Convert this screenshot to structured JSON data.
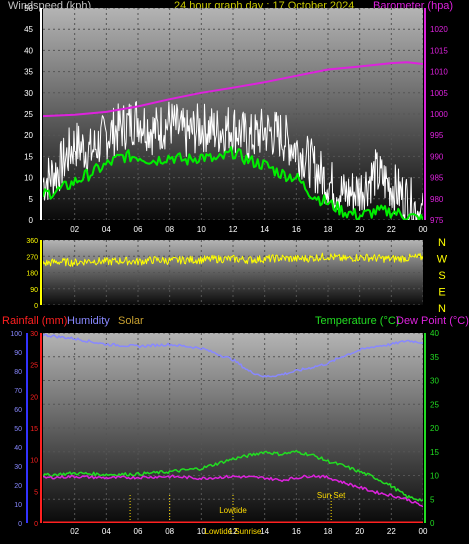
{
  "header": {
    "wind_label": "Windspeed (kph)",
    "title": "24 hour graph day : 17 October 2024",
    "baro_label": "Barometer (hpa)"
  },
  "colors": {
    "wind_gust": "#ffffff",
    "wind_avg": "#00ee00",
    "barometer": "#dd22dd",
    "wind_dir": "#ffff00",
    "humidity": "#8888ff",
    "temperature": "#22dd22",
    "dew_point": "#dd22dd",
    "rainfall": "#ff2020",
    "solar": "#c8a030",
    "axis_left_bottom": "#3333ff",
    "tide": "#ffdd00"
  },
  "bottom_labels": {
    "rain": "Rainfall (mm)",
    "humidity": "Humidity",
    "solar": "Solar",
    "temperature": "Temperature (°C)",
    "dewpoint": "Dew Point (°C)"
  },
  "annotations": {
    "lowtide_1": "Lowtide",
    "lowtide_2": "Lowtide",
    "sunrise": "Sunrise",
    "sunset": "Sun Set"
  },
  "compass": [
    "N",
    "W",
    "S",
    "E",
    "N"
  ],
  "chart_data": [
    {
      "type": "line",
      "x_tick_labels": [
        "02",
        "04",
        "06",
        "08",
        "10",
        "12",
        "14",
        "16",
        "18",
        "20",
        "22",
        "00"
      ],
      "xlim_hours": [
        0,
        24
      ],
      "y_left": {
        "ticks": [
          "0",
          "5",
          "10",
          "15",
          "20",
          "25",
          "30",
          "35",
          "40",
          "45",
          "50"
        ],
        "ylim": [
          0,
          50
        ]
      },
      "y_right": {
        "ticks": [
          "975",
          "980",
          "985",
          "990",
          "995",
          "1000",
          "1005",
          "1010",
          "1015",
          "1020"
        ],
        "ylim": [
          975,
          1025
        ]
      },
      "series": [
        {
          "name": "Windspeed (kph)",
          "role": "gust",
          "x": [
            0,
            1,
            2,
            3,
            4,
            5,
            6,
            7,
            8,
            9,
            10,
            11,
            12,
            13,
            14,
            15,
            16,
            17,
            18,
            19,
            20,
            21,
            22,
            23,
            24
          ],
          "y": [
            9,
            12,
            18,
            16,
            20,
            22,
            24,
            21,
            23,
            20,
            22,
            21,
            22,
            19,
            21,
            20,
            17,
            13,
            9,
            6,
            7,
            11,
            8,
            5,
            1
          ]
        },
        {
          "name": "Windspeed (kph)",
          "role": "average",
          "x": [
            0,
            1,
            2,
            3,
            4,
            5,
            6,
            7,
            8,
            9,
            10,
            11,
            12,
            13,
            14,
            15,
            16,
            17,
            18,
            19,
            20,
            21,
            22,
            23,
            24
          ],
          "y": [
            6,
            7,
            9,
            11,
            13,
            15,
            15,
            14,
            15,
            14,
            15,
            14,
            16,
            14,
            13,
            11,
            10,
            6,
            4,
            2,
            1,
            2,
            2,
            1,
            0
          ]
        },
        {
          "name": "Barometer (hpa)",
          "x": [
            0,
            2,
            4,
            6,
            8,
            10,
            12,
            14,
            16,
            18,
            20,
            22,
            23,
            24
          ],
          "y": [
            999.5,
            999.8,
            1000.5,
            1001.8,
            1003.5,
            1005,
            1006.2,
            1007.5,
            1009,
            1010.5,
            1011.2,
            1012,
            1012.2,
            1011.8
          ]
        }
      ]
    },
    {
      "type": "line",
      "y_ticks": [
        "360",
        "270",
        "180",
        "90",
        "0"
      ],
      "ylim": [
        0,
        360
      ],
      "series": [
        {
          "name": "Wind direction",
          "x": [
            0,
            1,
            2,
            3,
            4,
            5,
            6,
            7,
            8,
            9,
            10,
            11,
            12,
            13,
            14,
            15,
            16,
            17,
            18,
            19,
            20,
            21,
            22,
            23,
            24
          ],
          "y": [
            230,
            240,
            235,
            245,
            240,
            245,
            240,
            250,
            245,
            250,
            250,
            255,
            255,
            250,
            255,
            260,
            255,
            260,
            270,
            255,
            265,
            260,
            255,
            260,
            265
          ]
        }
      ]
    },
    {
      "type": "line",
      "y_left_rain": {
        "ticks": [
          "0",
          "5",
          "10",
          "15",
          "20",
          "25",
          "30"
        ],
        "ylim": [
          0,
          30
        ]
      },
      "y_left_humidity": {
        "ticks": [
          "0",
          "10",
          "20",
          "30",
          "40",
          "50",
          "60",
          "70",
          "80",
          "90",
          "100"
        ],
        "ylim": [
          0,
          100
        ]
      },
      "y_right": {
        "ticks": [
          "0",
          "5",
          "10",
          "15",
          "20",
          "25",
          "30",
          "35",
          "40"
        ],
        "ylim": [
          0,
          40
        ]
      },
      "series": [
        {
          "name": "Humidity",
          "x": [
            0,
            2,
            4,
            6,
            8,
            10,
            12,
            13,
            14,
            15,
            16,
            17,
            18,
            19,
            20,
            21,
            22,
            23,
            24
          ],
          "y": [
            99,
            97,
            94,
            93,
            94,
            92,
            86,
            80,
            77,
            78,
            80,
            82,
            84,
            88,
            91,
            93,
            94,
            96,
            95
          ]
        },
        {
          "name": "Temperature (°C)",
          "x": [
            0,
            2,
            4,
            6,
            8,
            10,
            11,
            12,
            13,
            14,
            15,
            16,
            17,
            18,
            19,
            20,
            21,
            22,
            23,
            24
          ],
          "y": [
            10,
            10.5,
            10.2,
            10.3,
            10.8,
            11.5,
            12.5,
            13.5,
            14.2,
            15,
            14.5,
            15,
            14.3,
            13,
            12,
            10.8,
            9.5,
            7.8,
            5.5,
            4.8
          ]
        },
        {
          "name": "Dew Point (°C)",
          "x": [
            0,
            2,
            4,
            6,
            8,
            10,
            12,
            14,
            15,
            16,
            17,
            18,
            19,
            20,
            21,
            22,
            23,
            24
          ],
          "y": [
            9.5,
            9.8,
            9.5,
            9.6,
            9.8,
            9.4,
            9.8,
            9.5,
            9.0,
            9.5,
            10,
            9.6,
            8.5,
            7.5,
            6.5,
            5.8,
            5,
            3.5
          ]
        },
        {
          "name": "Rainfall (mm)",
          "x": [
            0,
            24
          ],
          "y": [
            0,
            0
          ]
        }
      ],
      "events": [
        {
          "label": "Lowtide",
          "hour": 5.5
        },
        {
          "label": "Sunrise",
          "hour": 8.0
        },
        {
          "label": "Lowtide",
          "hour": 12.0
        },
        {
          "label": "Sun Set",
          "hour": 18.2
        }
      ]
    }
  ]
}
